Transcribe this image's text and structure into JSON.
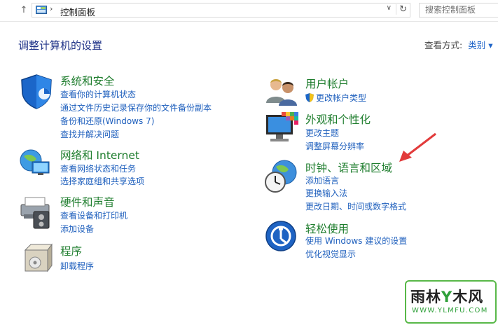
{
  "address_bar": {
    "back_arrow": "↑",
    "path_separator": "›",
    "path": "控制面板",
    "dropdown": "∨",
    "refresh": "↻",
    "search_placeholder": "搜索控制面板"
  },
  "page": {
    "heading": "调整计算机的设置",
    "view_label": "查看方式:",
    "view_value": "类别 ▾"
  },
  "categories": [
    {
      "title": "系统和安全",
      "icon": "shield-icon",
      "links": [
        "查看你的计算机状态",
        "通过文件历史记录保存你的文件备份副本",
        "备份和还原(Windows 7)",
        "查找并解决问题"
      ]
    },
    {
      "title": "网络和 Internet",
      "icon": "network-globe-icon",
      "links": [
        "查看网络状态和任务",
        "选择家庭组和共享选项"
      ]
    },
    {
      "title": "硬件和声音",
      "icon": "printer-speaker-icon",
      "links": [
        "查看设备和打印机",
        "添加设备"
      ]
    },
    {
      "title": "程序",
      "icon": "programs-box-icon",
      "links": [
        "卸载程序"
      ]
    },
    {
      "title": "用户帐户",
      "icon": "users-icon",
      "links": [
        "更改帐户类型"
      ]
    },
    {
      "title": "外观和个性化",
      "icon": "monitor-palette-icon",
      "links": [
        "更改主题",
        "调整屏幕分辨率"
      ]
    },
    {
      "title": "时钟、语言和区域",
      "icon": "clock-globe-icon",
      "links": [
        "添加语言",
        "更换输入法",
        "更改日期、时间或数字格式"
      ]
    },
    {
      "title": "轻松使用",
      "icon": "ease-of-access-icon",
      "links": [
        "使用 Windows 建议的设置",
        "优化视觉显示"
      ]
    }
  ],
  "watermark": {
    "brand_a": "雨林",
    "brand_b": "木风",
    "url": "WWW.YLMFU.COM"
  },
  "colors": {
    "title_green": "#1e7d2d",
    "link_blue": "#1e5fbd",
    "heading_blue": "#1e3287",
    "arrow_red": "#e23b3b"
  }
}
